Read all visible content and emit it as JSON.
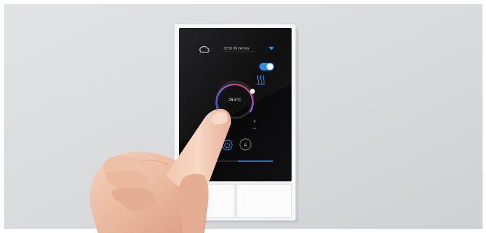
{
  "scene": {
    "background_color": "#d9dadc",
    "frame_color": "#ffffff"
  },
  "thermostat": {
    "header_time": "15:50 09 viernes",
    "temperature": "26.5°C",
    "dial_accent_start": "#2f5fd6",
    "dial_accent_mid": "#8b5bd8",
    "dial_accent_end": "#e8334d",
    "toggle_color": "#2b8fe8",
    "toggle_on": true,
    "icons": {
      "cloud": "cloud-icon",
      "dropdown": "triangle-down-icon",
      "heat_mode": "heat-waves-icon",
      "power": "power-icon",
      "auto_mode": "auto-a-icon",
      "plus": "plus-icon",
      "minus": "minus-icon"
    }
  }
}
